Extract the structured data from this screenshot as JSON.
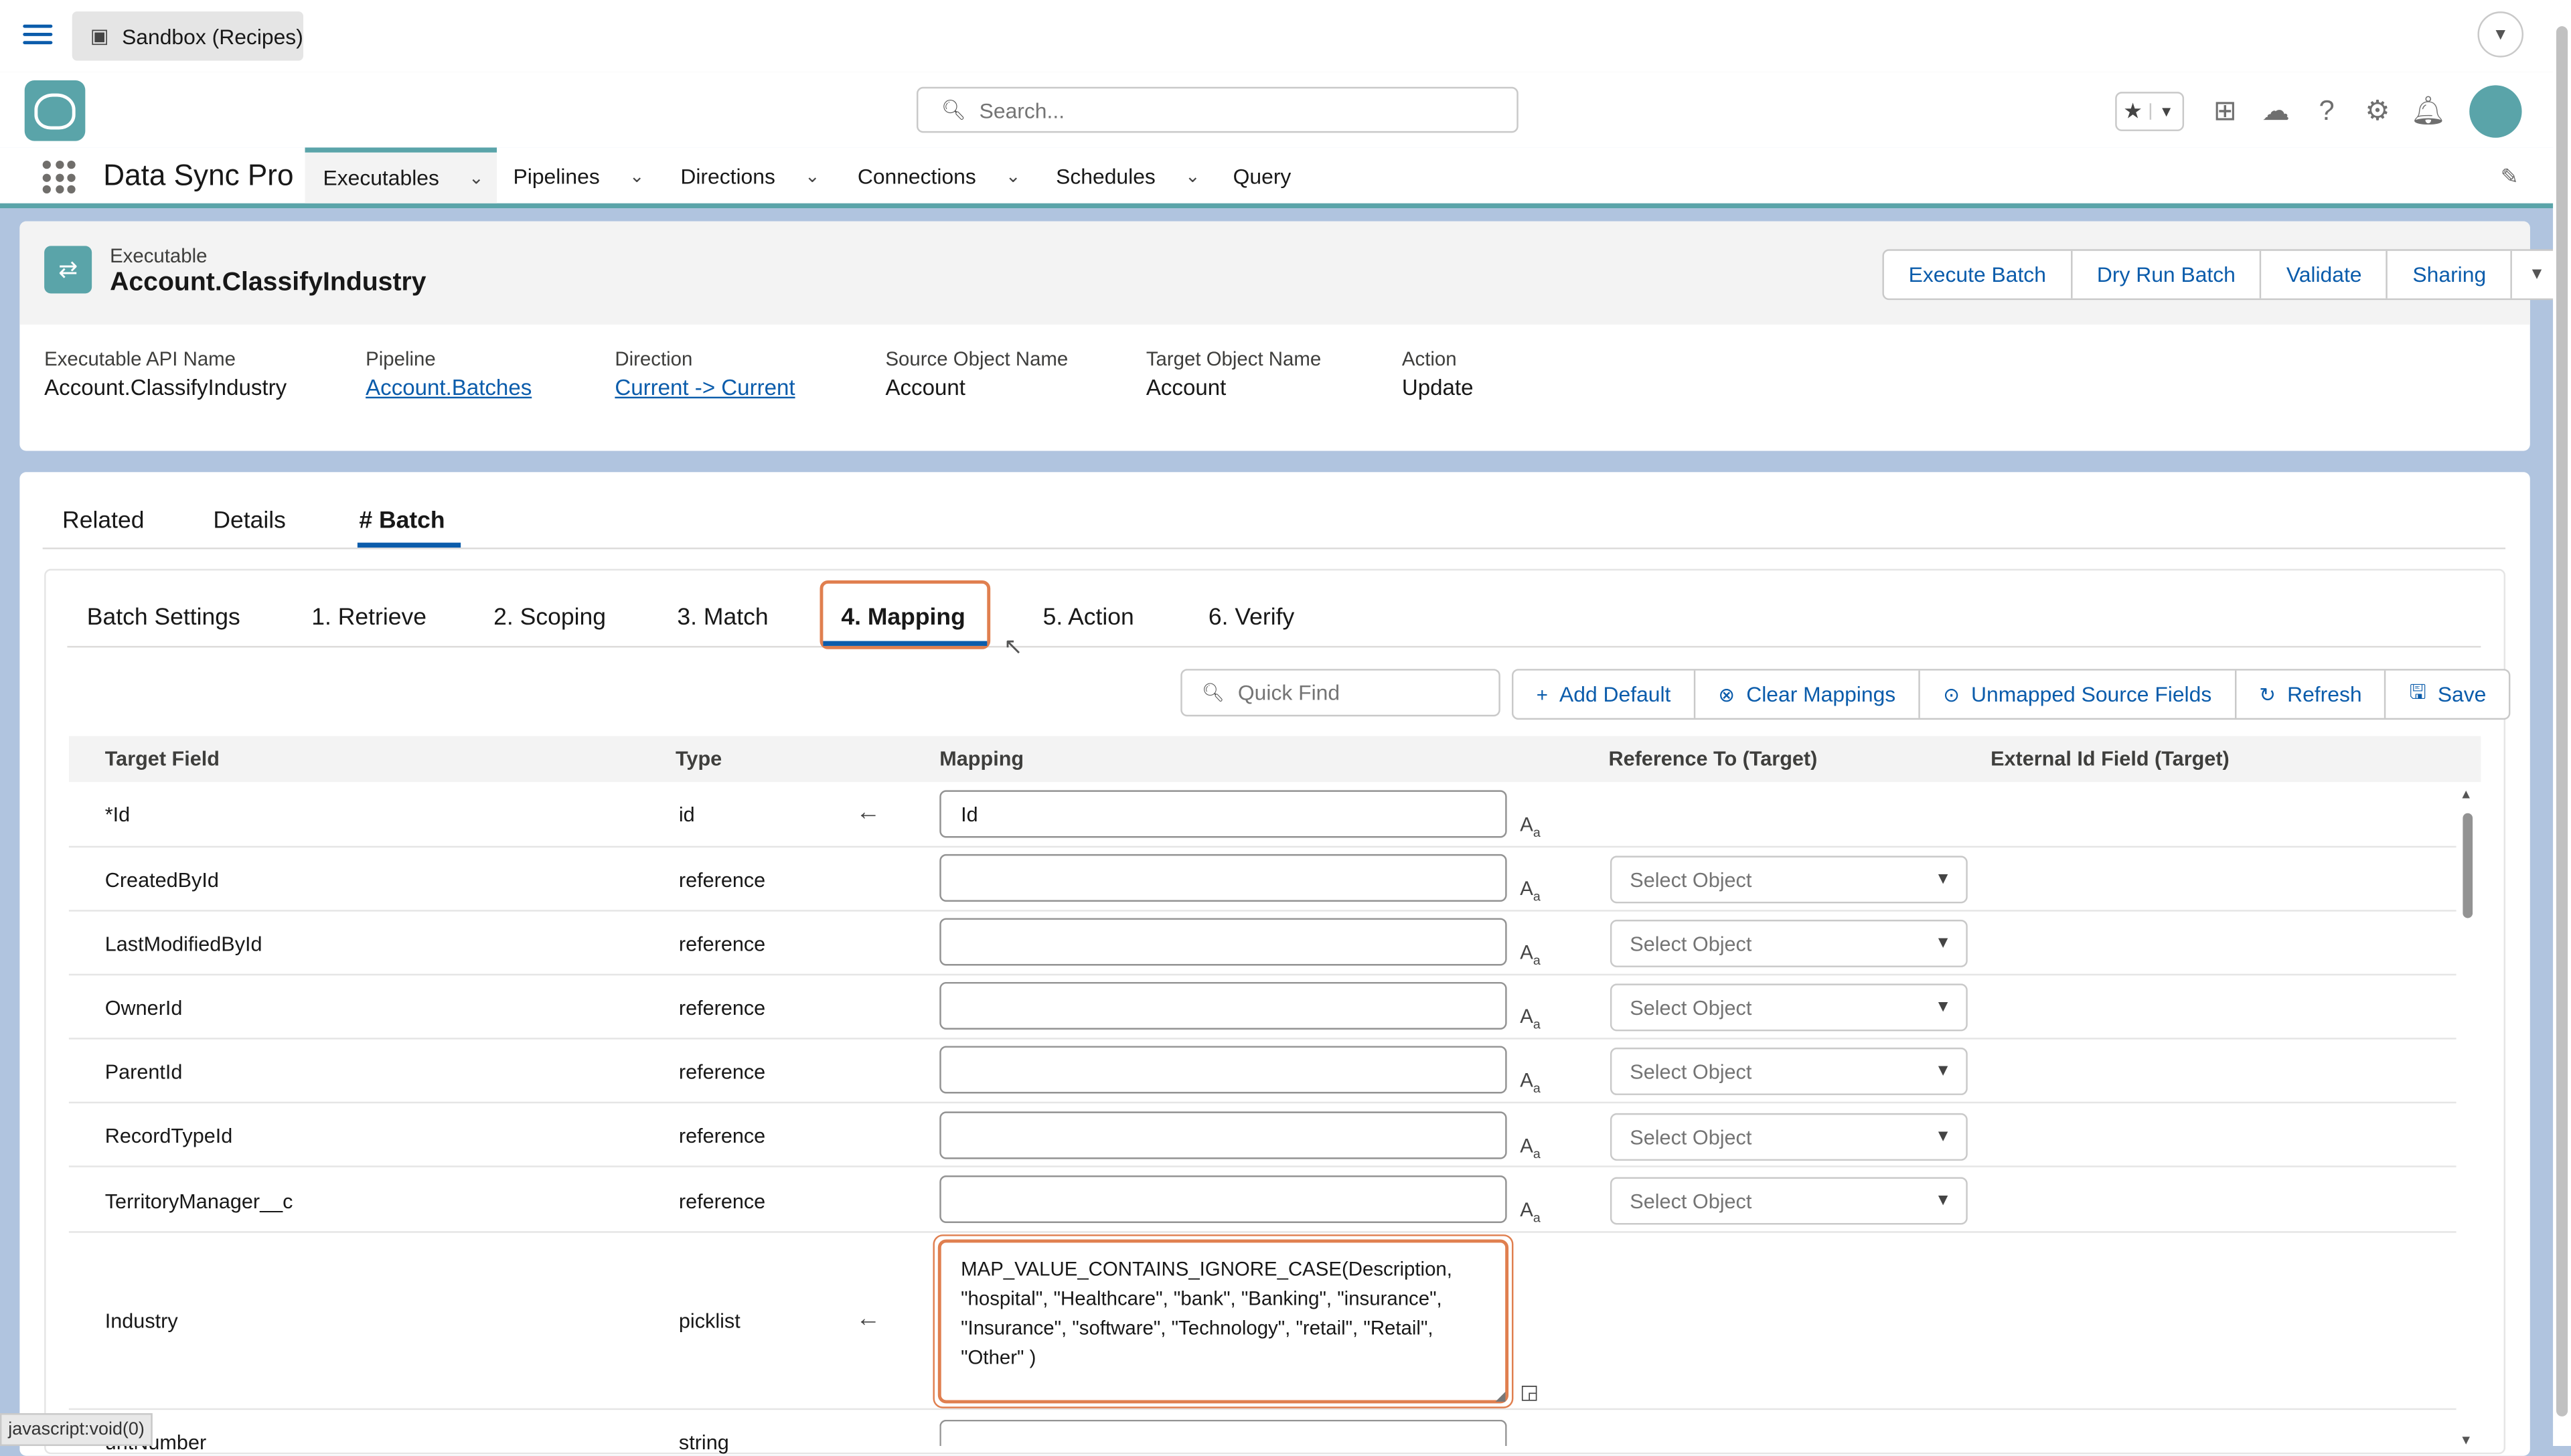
{
  "topbar": {
    "sandbox_tab": "Sandbox (Recipes)"
  },
  "header": {
    "search_placeholder": "Search..."
  },
  "nav": {
    "app_name": "Data Sync Pro",
    "items": [
      {
        "label": "Executables"
      },
      {
        "label": "Pipelines"
      },
      {
        "label": "Directions"
      },
      {
        "label": "Connections"
      },
      {
        "label": "Schedules"
      },
      {
        "label": "Query"
      }
    ]
  },
  "record": {
    "object_label": "Executable",
    "title": "Account.ClassifyIndustry",
    "actions": [
      "Execute Batch",
      "Dry Run Batch",
      "Validate",
      "Sharing"
    ],
    "fields": [
      {
        "label": "Executable API Name",
        "value": "Account.ClassifyIndustry"
      },
      {
        "label": "Pipeline",
        "value": "Account.Batches"
      },
      {
        "label": "Direction",
        "value": "Current -> Current"
      },
      {
        "label": "Source Object Name",
        "value": "Account"
      },
      {
        "label": "Target Object Name",
        "value": "Account"
      },
      {
        "label": "Action",
        "value": "Update"
      }
    ]
  },
  "tabs": [
    "Related",
    "Details",
    "# Batch"
  ],
  "subtabs": [
    "Batch Settings",
    "1. Retrieve",
    "2. Scoping",
    "3. Match",
    "4. Mapping",
    "5. Action",
    "6. Verify"
  ],
  "toolbar": {
    "quick_find_placeholder": "Quick Find",
    "buttons": [
      "Add Default",
      "Clear Mappings",
      "Unmapped Source Fields",
      "Refresh",
      "Save"
    ]
  },
  "table": {
    "headers": [
      "Target Field",
      "Type",
      "Mapping",
      "Reference To (Target)",
      "External Id Field (Target)"
    ],
    "select_placeholder": "Select Object",
    "rows": [
      {
        "field": "*Id",
        "type": "id",
        "mapping": "Id"
      },
      {
        "field": "CreatedById",
        "type": "reference",
        "mapping": ""
      },
      {
        "field": "LastModifiedById",
        "type": "reference",
        "mapping": ""
      },
      {
        "field": "OwnerId",
        "type": "reference",
        "mapping": ""
      },
      {
        "field": "ParentId",
        "type": "reference",
        "mapping": ""
      },
      {
        "field": "RecordTypeId",
        "type": "reference",
        "mapping": ""
      },
      {
        "field": "TerritoryManager__c",
        "type": "reference",
        "mapping": ""
      },
      {
        "field": "Industry",
        "type": "picklist",
        "mapping": "MAP_VALUE_CONTAINS_IGNORE_CASE(Description, \"hospital\", \"Healthcare\", \"bank\", \"Banking\", \"insurance\", \"Insurance\", \"software\", \"Technology\", \"retail\", \"Retail\", \"Other\" )"
      },
      {
        "field": "untNumber",
        "type": "string",
        "mapping": ""
      }
    ]
  },
  "status_bar": "javascript:void(0)"
}
